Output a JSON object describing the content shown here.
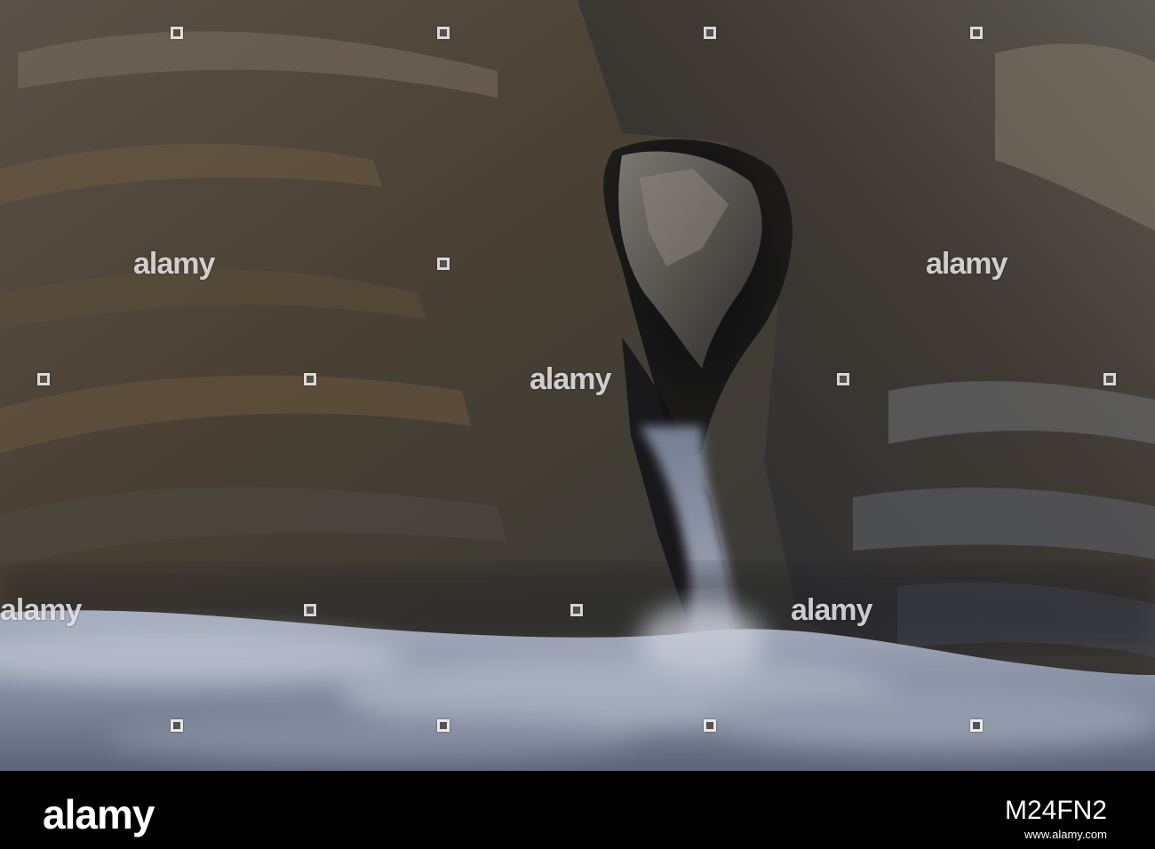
{
  "photo": {
    "description_tags": [
      "sea-arch",
      "layered-slate-rock",
      "long-exposure-sea-mist"
    ],
    "watermark_text": "alamy",
    "colors": {
      "rock_dark": "#1c1b1a",
      "rock_mid": "#4a4236",
      "rock_warm": "#6b5a44",
      "rock_grey": "#6d6f6c",
      "mist": "#8e98ab",
      "mist_light": "#c7cbd6"
    }
  },
  "footer": {
    "logo": "alamy",
    "image_id": "M24FN2",
    "url": "www.alamy.com"
  }
}
